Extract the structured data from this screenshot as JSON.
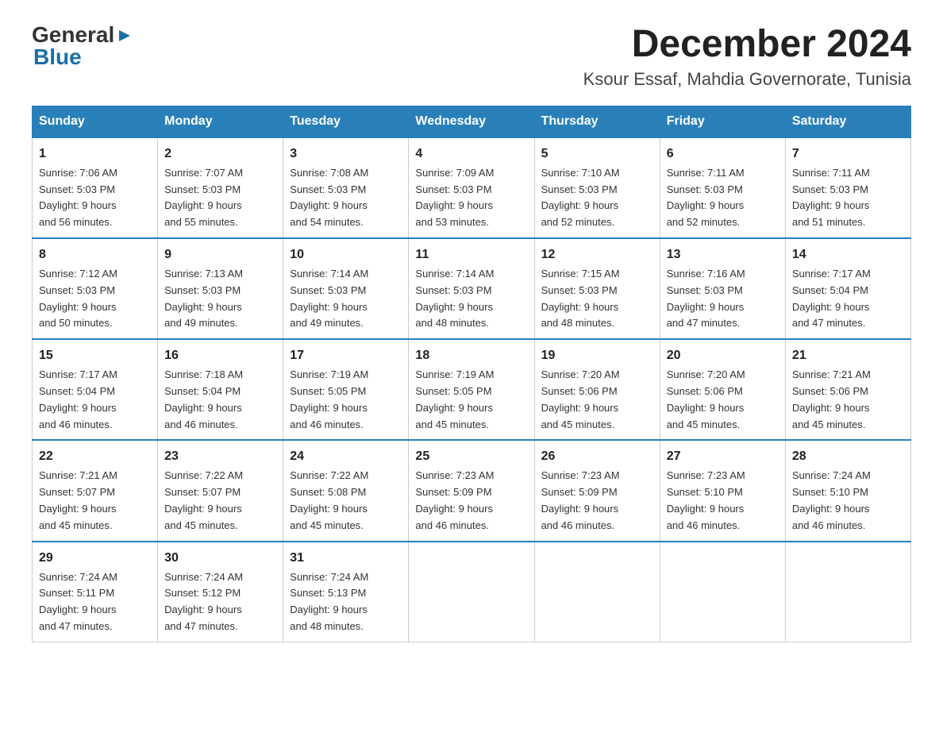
{
  "header": {
    "logo_general": "General",
    "logo_blue": "Blue",
    "month_title": "December 2024",
    "subtitle": "Ksour Essaf, Mahdia Governorate, Tunisia"
  },
  "weekdays": [
    "Sunday",
    "Monday",
    "Tuesday",
    "Wednesday",
    "Thursday",
    "Friday",
    "Saturday"
  ],
  "weeks": [
    [
      {
        "day": "1",
        "sunrise": "7:06 AM",
        "sunset": "5:03 PM",
        "daylight": "9 hours and 56 minutes."
      },
      {
        "day": "2",
        "sunrise": "7:07 AM",
        "sunset": "5:03 PM",
        "daylight": "9 hours and 55 minutes."
      },
      {
        "day": "3",
        "sunrise": "7:08 AM",
        "sunset": "5:03 PM",
        "daylight": "9 hours and 54 minutes."
      },
      {
        "day": "4",
        "sunrise": "7:09 AM",
        "sunset": "5:03 PM",
        "daylight": "9 hours and 53 minutes."
      },
      {
        "day": "5",
        "sunrise": "7:10 AM",
        "sunset": "5:03 PM",
        "daylight": "9 hours and 52 minutes."
      },
      {
        "day": "6",
        "sunrise": "7:11 AM",
        "sunset": "5:03 PM",
        "daylight": "9 hours and 52 minutes."
      },
      {
        "day": "7",
        "sunrise": "7:11 AM",
        "sunset": "5:03 PM",
        "daylight": "9 hours and 51 minutes."
      }
    ],
    [
      {
        "day": "8",
        "sunrise": "7:12 AM",
        "sunset": "5:03 PM",
        "daylight": "9 hours and 50 minutes."
      },
      {
        "day": "9",
        "sunrise": "7:13 AM",
        "sunset": "5:03 PM",
        "daylight": "9 hours and 49 minutes."
      },
      {
        "day": "10",
        "sunrise": "7:14 AM",
        "sunset": "5:03 PM",
        "daylight": "9 hours and 49 minutes."
      },
      {
        "day": "11",
        "sunrise": "7:14 AM",
        "sunset": "5:03 PM",
        "daylight": "9 hours and 48 minutes."
      },
      {
        "day": "12",
        "sunrise": "7:15 AM",
        "sunset": "5:03 PM",
        "daylight": "9 hours and 48 minutes."
      },
      {
        "day": "13",
        "sunrise": "7:16 AM",
        "sunset": "5:03 PM",
        "daylight": "9 hours and 47 minutes."
      },
      {
        "day": "14",
        "sunrise": "7:17 AM",
        "sunset": "5:04 PM",
        "daylight": "9 hours and 47 minutes."
      }
    ],
    [
      {
        "day": "15",
        "sunrise": "7:17 AM",
        "sunset": "5:04 PM",
        "daylight": "9 hours and 46 minutes."
      },
      {
        "day": "16",
        "sunrise": "7:18 AM",
        "sunset": "5:04 PM",
        "daylight": "9 hours and 46 minutes."
      },
      {
        "day": "17",
        "sunrise": "7:19 AM",
        "sunset": "5:05 PM",
        "daylight": "9 hours and 46 minutes."
      },
      {
        "day": "18",
        "sunrise": "7:19 AM",
        "sunset": "5:05 PM",
        "daylight": "9 hours and 45 minutes."
      },
      {
        "day": "19",
        "sunrise": "7:20 AM",
        "sunset": "5:06 PM",
        "daylight": "9 hours and 45 minutes."
      },
      {
        "day": "20",
        "sunrise": "7:20 AM",
        "sunset": "5:06 PM",
        "daylight": "9 hours and 45 minutes."
      },
      {
        "day": "21",
        "sunrise": "7:21 AM",
        "sunset": "5:06 PM",
        "daylight": "9 hours and 45 minutes."
      }
    ],
    [
      {
        "day": "22",
        "sunrise": "7:21 AM",
        "sunset": "5:07 PM",
        "daylight": "9 hours and 45 minutes."
      },
      {
        "day": "23",
        "sunrise": "7:22 AM",
        "sunset": "5:07 PM",
        "daylight": "9 hours and 45 minutes."
      },
      {
        "day": "24",
        "sunrise": "7:22 AM",
        "sunset": "5:08 PM",
        "daylight": "9 hours and 45 minutes."
      },
      {
        "day": "25",
        "sunrise": "7:23 AM",
        "sunset": "5:09 PM",
        "daylight": "9 hours and 46 minutes."
      },
      {
        "day": "26",
        "sunrise": "7:23 AM",
        "sunset": "5:09 PM",
        "daylight": "9 hours and 46 minutes."
      },
      {
        "day": "27",
        "sunrise": "7:23 AM",
        "sunset": "5:10 PM",
        "daylight": "9 hours and 46 minutes."
      },
      {
        "day": "28",
        "sunrise": "7:24 AM",
        "sunset": "5:10 PM",
        "daylight": "9 hours and 46 minutes."
      }
    ],
    [
      {
        "day": "29",
        "sunrise": "7:24 AM",
        "sunset": "5:11 PM",
        "daylight": "9 hours and 47 minutes."
      },
      {
        "day": "30",
        "sunrise": "7:24 AM",
        "sunset": "5:12 PM",
        "daylight": "9 hours and 47 minutes."
      },
      {
        "day": "31",
        "sunrise": "7:24 AM",
        "sunset": "5:13 PM",
        "daylight": "9 hours and 48 minutes."
      },
      null,
      null,
      null,
      null
    ]
  ],
  "labels": {
    "sunrise": "Sunrise:",
    "sunset": "Sunset:",
    "daylight": "Daylight:"
  }
}
